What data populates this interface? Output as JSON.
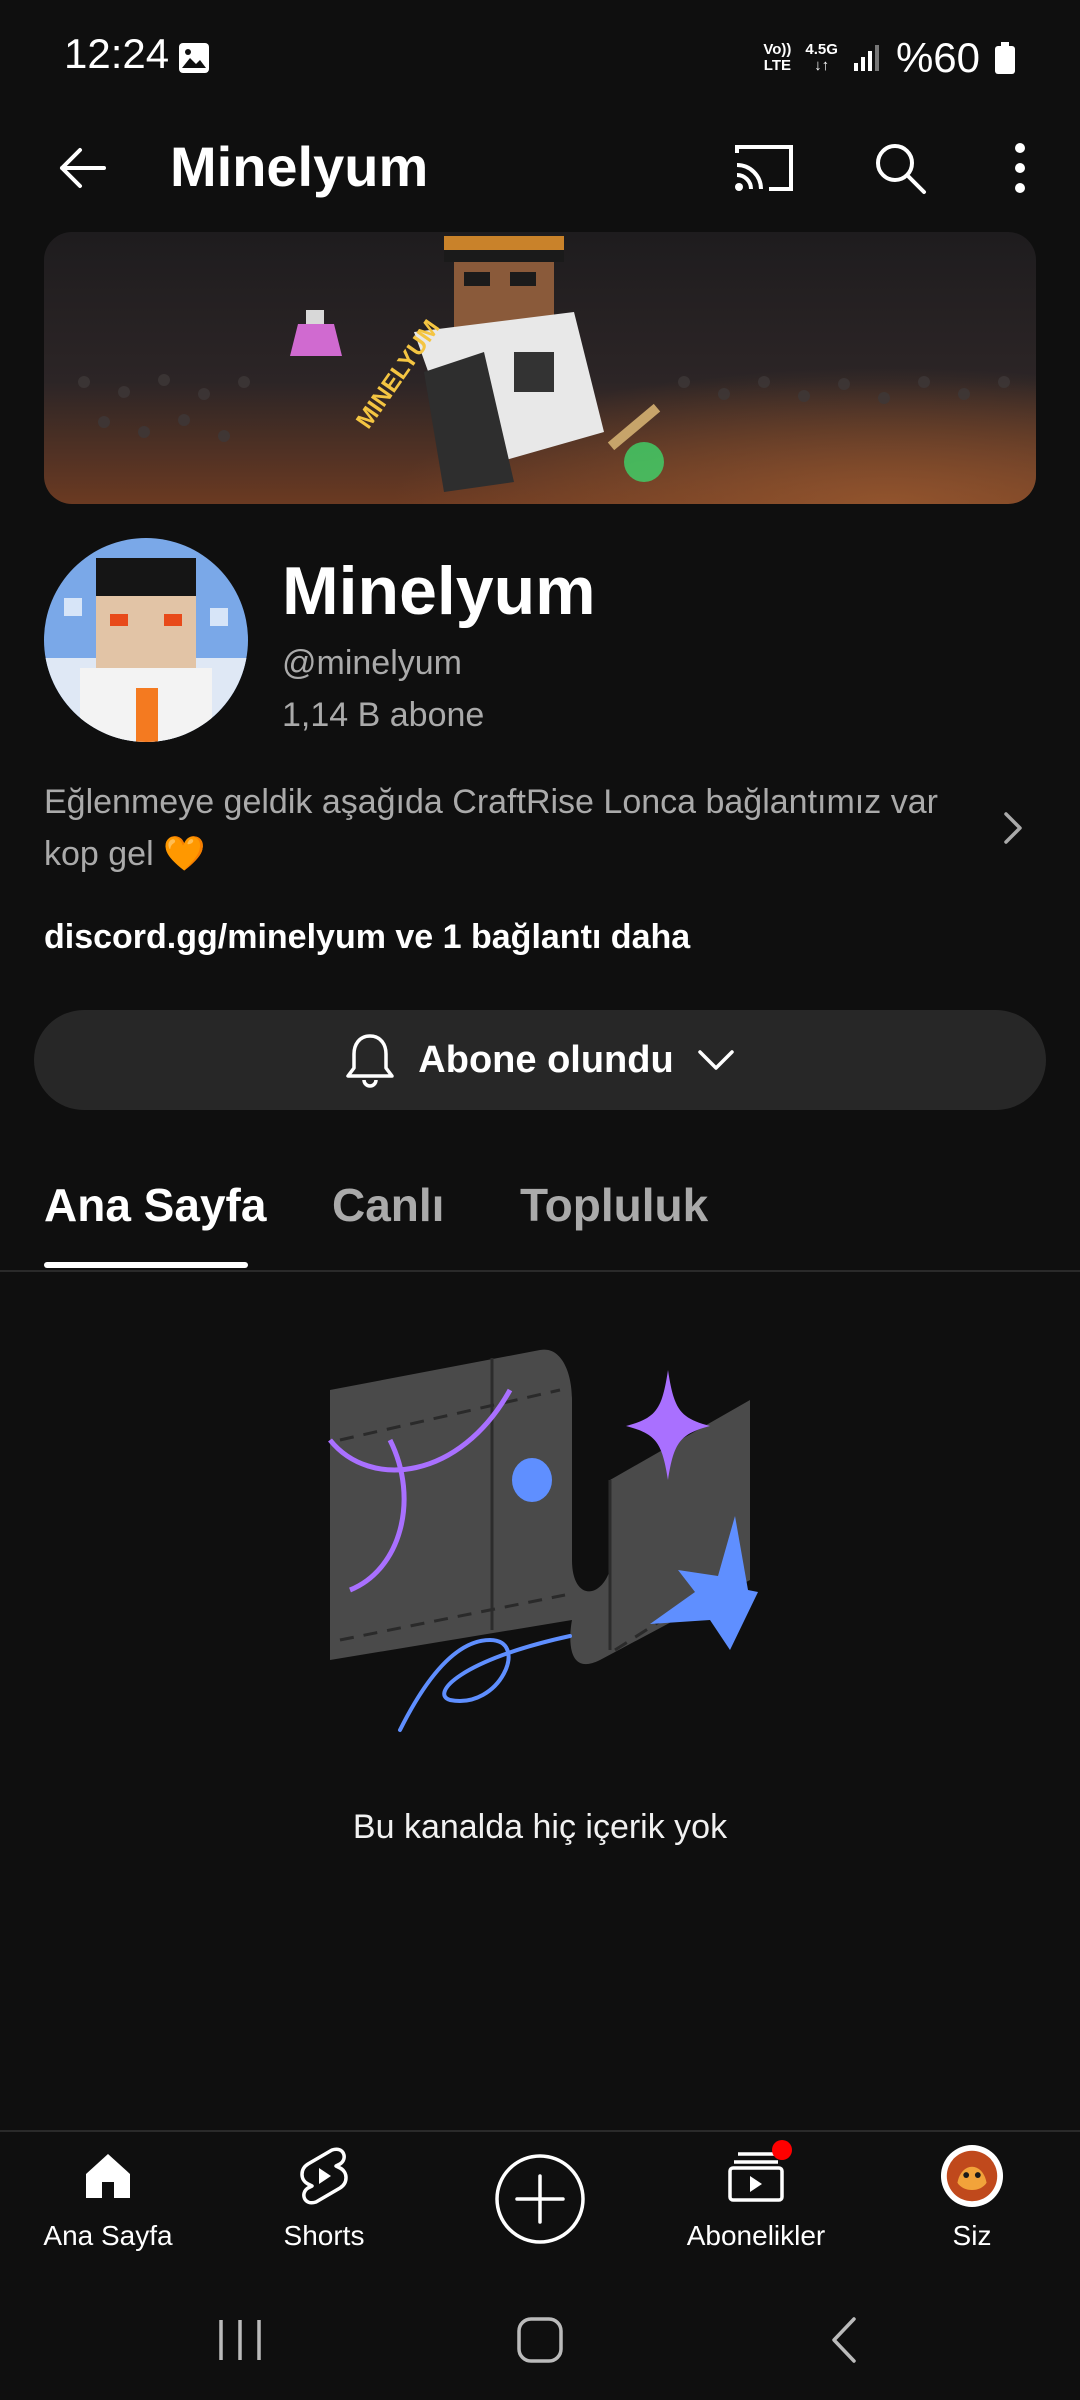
{
  "status_bar": {
    "time": "12:24",
    "network_top": "Vo))",
    "network_bottom": "LTE",
    "data_top": "4.5G",
    "data_bottom": "↓↑",
    "battery": "%60"
  },
  "app_bar": {
    "title": "Minelyum"
  },
  "channel": {
    "name": "Minelyum",
    "handle": "@minelyum",
    "subscribers": "1,14 B abone",
    "description_line1": "Eğlenmeye geldik aşağıda CraftRise Lonca bağlantımız var",
    "description_line2": "kop gel 🧡",
    "links": "discord.gg/minelyum ve 1 bağlantı daha",
    "banner_text": "MINELYUM"
  },
  "subscribe_button": {
    "label": "Abone olundu"
  },
  "tabs": [
    {
      "label": "Ana Sayfa",
      "active": true
    },
    {
      "label": "Canlı",
      "active": false
    },
    {
      "label": "Topluluk",
      "active": false
    }
  ],
  "empty_state": {
    "message": "Bu kanalda hiç içerik yok"
  },
  "bottom_nav": {
    "home": "Ana Sayfa",
    "shorts": "Shorts",
    "subscriptions": "Abonelikler",
    "you": "Siz"
  },
  "colors": {
    "background": "#0f0f0f",
    "surface": "#272727",
    "secondary_text": "#aaaaaa",
    "accent_purple": "#a970ff",
    "accent_blue": "#5f8fff",
    "notification_red": "#ff0000"
  }
}
